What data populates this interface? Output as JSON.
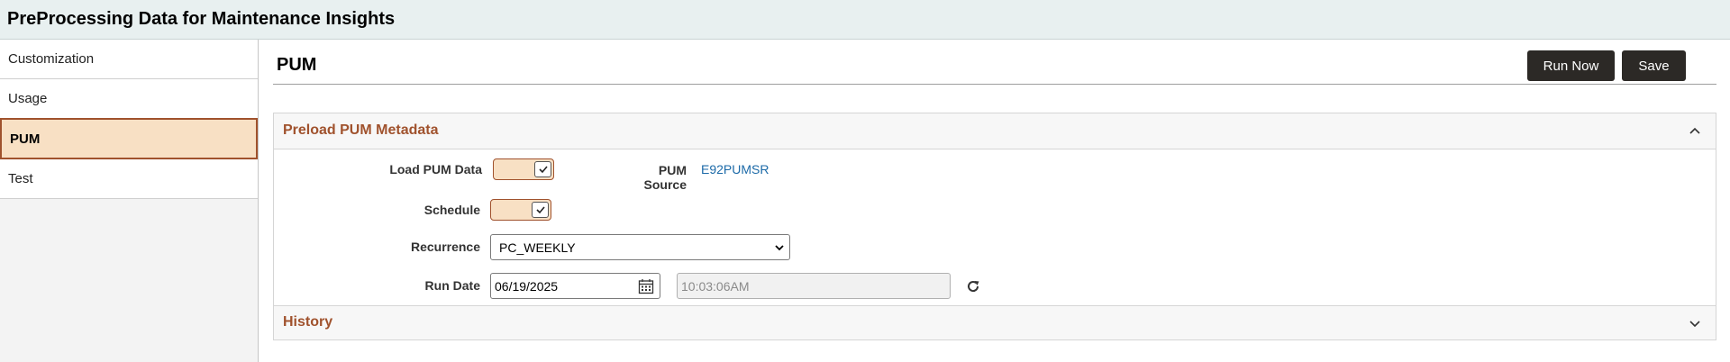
{
  "app": {
    "title": "PreProcessing Data for Maintenance Insights"
  },
  "sidebar": {
    "items": [
      {
        "label": "Customization",
        "active": false
      },
      {
        "label": "Usage",
        "active": false
      },
      {
        "label": "PUM",
        "active": true
      },
      {
        "label": "Test",
        "active": false
      }
    ]
  },
  "page": {
    "title": "PUM",
    "run_now_label": "Run Now",
    "save_label": "Save"
  },
  "preload_section": {
    "title": "Preload PUM Metadata",
    "expanded": true,
    "load_pum_data_label": "Load PUM Data",
    "load_pum_data_checked": true,
    "pum_source_label": "PUM Source",
    "pum_source_value": "E92PUMSR",
    "schedule_label": "Schedule",
    "schedule_checked": true,
    "recurrence_label": "Recurrence",
    "recurrence_value": "PC_WEEKLY",
    "run_date_label": "Run Date",
    "run_date_value": "06/19/2025",
    "run_time_value": "10:03:06AM"
  },
  "history_section": {
    "title": "History",
    "expanded": false
  },
  "colors": {
    "accent": "#a0522d",
    "active_bg": "#f8e0c4",
    "button_bg": "#2c2926",
    "link": "#1c6aa8",
    "topbar_bg": "#e8f0f0"
  },
  "icons": {
    "collapse": "chevron-up-icon",
    "expand": "chevron-down-icon",
    "calendar": "calendar-icon",
    "refresh": "refresh-icon",
    "check": "checkmark-icon"
  }
}
